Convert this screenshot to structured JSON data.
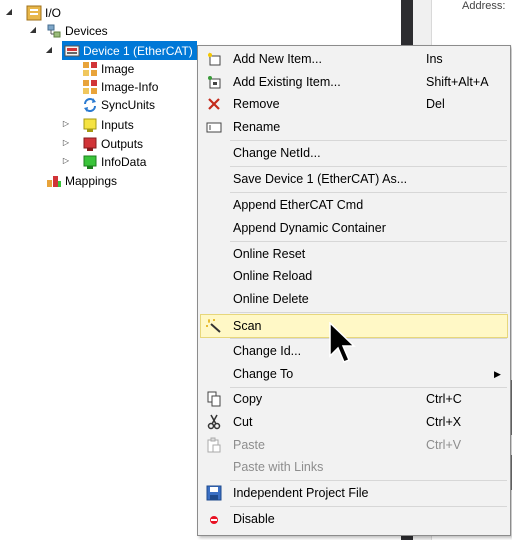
{
  "tree": {
    "io": "I/O",
    "devices": "Devices",
    "device1": "Device 1 (EtherCAT)",
    "children": [
      "Image",
      "Image-Info",
      "SyncUnits",
      "Inputs",
      "Outputs",
      "InfoData"
    ],
    "mappings": "Mappings"
  },
  "right_panel": {
    "address_label": "IP Address:"
  },
  "menu": {
    "items": [
      {
        "label": "Add New Item...",
        "shortcut": "Ins",
        "icon": "add-new-item-icon"
      },
      {
        "label": "Add Existing Item...",
        "shortcut": "Shift+Alt+A",
        "icon": "add-existing-item-icon"
      },
      {
        "label": "Remove",
        "shortcut": "Del",
        "icon": "remove-x-icon"
      },
      {
        "label": "Rename",
        "shortcut": "",
        "icon": "rename-icon"
      },
      {
        "label": "Change NetId...",
        "shortcut": ""
      },
      {
        "label": "Save Device 1 (EtherCAT) As...",
        "shortcut": ""
      },
      {
        "label": "Append EtherCAT Cmd",
        "shortcut": ""
      },
      {
        "label": "Append Dynamic Container",
        "shortcut": ""
      },
      {
        "label": "Online Reset",
        "shortcut": ""
      },
      {
        "label": "Online Reload",
        "shortcut": ""
      },
      {
        "label": "Online Delete",
        "shortcut": ""
      },
      {
        "label": "Scan",
        "shortcut": "",
        "icon": "magic-wand-icon"
      },
      {
        "label": "Change Id...",
        "shortcut": ""
      },
      {
        "label": "Change To",
        "shortcut": "",
        "submenu": true
      },
      {
        "label": "Copy",
        "shortcut": "Ctrl+C",
        "icon": "copy-icon"
      },
      {
        "label": "Cut",
        "shortcut": "Ctrl+X",
        "icon": "cut-icon"
      },
      {
        "label": "Paste",
        "shortcut": "Ctrl+V",
        "icon": "paste-icon",
        "disabled": true
      },
      {
        "label": "Paste with Links",
        "shortcut": "",
        "disabled": true
      },
      {
        "label": "Independent Project File",
        "shortcut": "",
        "icon": "save-disk-icon"
      },
      {
        "label": "Disable",
        "shortcut": "",
        "icon": "disable-dot-icon"
      }
    ],
    "hover_item": "Scan"
  },
  "colors": {
    "selection": "#0078d7",
    "menu_bg": "#f2f2f2",
    "hover_bg": "#fff8c6",
    "remove": "#c42b1c",
    "disable": "#e81123"
  }
}
